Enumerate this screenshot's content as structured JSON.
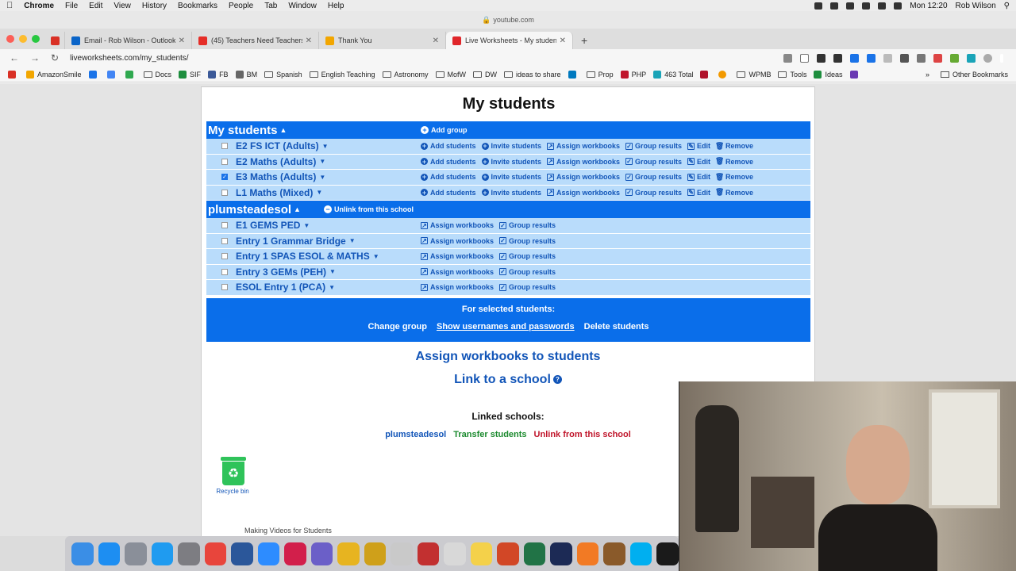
{
  "menubar": {
    "app": "Chrome",
    "items": [
      "File",
      "Edit",
      "View",
      "History",
      "Bookmarks",
      "People",
      "Tab",
      "Window",
      "Help"
    ],
    "clock": "Mon 12:20",
    "user": "Rob Wilson"
  },
  "browser": {
    "title_url": "youtube.com",
    "tabs": [
      {
        "label": "",
        "favicon_color": "#d93025",
        "icon": "gmail-icon"
      },
      {
        "label": "Email - Rob Wilson - Outlook",
        "favicon_color": "#0a64c8",
        "icon": "outlook-icon"
      },
      {
        "label": "(45) Teachers Need Teachers",
        "favicon_color": "#e52d27",
        "icon": "youtube-icon"
      },
      {
        "label": "Thank You",
        "favicon_color": "#f2a600",
        "icon": "amazon-icon"
      },
      {
        "label": "Live Worksheets - My students",
        "favicon_color": "#e0262a",
        "icon": "liveworksheets-icon",
        "active": true
      }
    ],
    "new_tab": "+",
    "address": "liveworksheets.com/my_students/",
    "bookmarks": [
      {
        "label": "",
        "icon": "gmail-icon",
        "color": "#d93025"
      },
      {
        "label": "AmazonSmile",
        "icon": "amazon-icon",
        "color": "#f2a600"
      },
      {
        "label": "",
        "icon": "calendar-icon",
        "color": "#1a73e8"
      },
      {
        "label": "",
        "icon": "google-icon",
        "color": "#4285f4"
      },
      {
        "label": "",
        "icon": "u-icon",
        "color": "#2fa84f"
      },
      {
        "label": "Docs",
        "icon": "folder",
        "color": ""
      },
      {
        "label": "SIF",
        "icon": "sheet-icon",
        "color": "#1e8e3e"
      },
      {
        "label": "FB",
        "icon": "facebook-icon",
        "color": "#3b5998"
      },
      {
        "label": "BM",
        "icon": "bm-icon",
        "color": "#666"
      },
      {
        "label": "Spanish",
        "icon": "folder",
        "color": ""
      },
      {
        "label": "English Teaching",
        "icon": "folder",
        "color": ""
      },
      {
        "label": "Astronomy",
        "icon": "folder",
        "color": ""
      },
      {
        "label": "MofW",
        "icon": "folder",
        "color": ""
      },
      {
        "label": "DW",
        "icon": "folder",
        "color": ""
      },
      {
        "label": "ideas to share",
        "icon": "folder",
        "color": ""
      },
      {
        "label": "",
        "icon": "trello-icon",
        "color": "#0079bf"
      },
      {
        "label": "Prop",
        "icon": "folder",
        "color": ""
      },
      {
        "label": "PHP",
        "icon": "php-icon",
        "color": "#c0152b"
      },
      {
        "label": "463 Total",
        "icon": "v-icon",
        "color": "#1aa4b8"
      },
      {
        "label": "",
        "icon": "red-square-icon",
        "color": "#b0122a"
      },
      {
        "label": "",
        "icon": "sun-icon",
        "color": "#f29900"
      },
      {
        "label": "WPMB",
        "icon": "folder",
        "color": ""
      },
      {
        "label": "Tools",
        "icon": "folder",
        "color": ""
      },
      {
        "label": "Ideas",
        "icon": "sheet-icon",
        "color": "#1e8e3e"
      },
      {
        "label": "",
        "icon": "purple-icon",
        "color": "#6a3ab2"
      }
    ],
    "other_bookmarks": "Other Bookmarks"
  },
  "page": {
    "title": "My students",
    "groups": [
      {
        "name": "My students",
        "header_action": "Add group",
        "header_icon": "plus-circle-icon",
        "rows": [
          {
            "name": "E2 FS ICT (Adults)",
            "checked": false,
            "actions": [
              "Add students",
              "Invite students",
              "Assign workbooks",
              "Group results",
              "Edit",
              "Remove"
            ]
          },
          {
            "name": "E2 Maths (Adults)",
            "checked": false,
            "actions": [
              "Add students",
              "Invite students",
              "Assign workbooks",
              "Group results",
              "Edit",
              "Remove"
            ]
          },
          {
            "name": "E3 Maths (Adults)",
            "checked": true,
            "actions": [
              "Add students",
              "Invite students",
              "Assign workbooks",
              "Group results",
              "Edit",
              "Remove"
            ]
          },
          {
            "name": "L1 Maths (Mixed)",
            "checked": false,
            "actions": [
              "Add students",
              "Invite students",
              "Assign workbooks",
              "Group results",
              "Edit",
              "Remove"
            ]
          }
        ]
      },
      {
        "name": "plumsteadesol",
        "header_action": "Unlink from this school",
        "header_icon": "minus-circle-icon",
        "rows": [
          {
            "name": "E1 GEMS PED",
            "checked": false,
            "actions": [
              "Assign workbooks",
              "Group results"
            ]
          },
          {
            "name": "Entry 1 Grammar Bridge",
            "checked": false,
            "actions": [
              "Assign workbooks",
              "Group results"
            ]
          },
          {
            "name": "Entry 1 SPAS ESOL & MATHS",
            "checked": false,
            "actions": [
              "Assign workbooks",
              "Group results"
            ]
          },
          {
            "name": "Entry 3 GEMs (PEH)",
            "checked": false,
            "actions": [
              "Assign workbooks",
              "Group results"
            ]
          },
          {
            "name": "ESOL Entry 1 (PCA)",
            "checked": false,
            "actions": [
              "Assign workbooks",
              "Group results"
            ]
          }
        ]
      }
    ],
    "selected_bar": {
      "title": "For selected students:",
      "change_group": "Change group",
      "show_passwords": "Show usernames and passwords",
      "delete": "Delete students"
    },
    "assign_link": "Assign workbooks to students",
    "school_link": "Link to a school",
    "help_mark": "?",
    "linked_title": "Linked schools:",
    "linked": {
      "school": "plumsteadesol",
      "transfer": "Transfer students",
      "unlink": "Unlink from this school"
    },
    "recycle_label": "Recycle bin",
    "footer_ghost": "Making Videos for Students"
  },
  "colors": {
    "accent": "#0a6eea",
    "row_bg": "#b9dcfb",
    "link": "#1255b8",
    "transfer": "#1b8a2e",
    "unlink": "#c0152b"
  },
  "dock": [
    {
      "name": "finder-icon",
      "color": "#3a8ee6"
    },
    {
      "name": "app-store-icon",
      "color": "#1d8ef2"
    },
    {
      "name": "launchpad-icon",
      "color": "#8a8f99"
    },
    {
      "name": "safari-icon",
      "color": "#1f9bf0"
    },
    {
      "name": "system-preferences-icon",
      "color": "#7d7d82"
    },
    {
      "name": "chrome-icon",
      "color": "#e8453c"
    },
    {
      "name": "word-icon",
      "color": "#2b579a"
    },
    {
      "name": "zoom-icon",
      "color": "#2d8cff"
    },
    {
      "name": "lips-icon",
      "color": "#d21f4b"
    },
    {
      "name": "imovie-icon",
      "color": "#6b5fc8"
    },
    {
      "name": "bus-icon",
      "color": "#e7b420"
    },
    {
      "name": "sticky-icon",
      "color": "#cfa01a"
    },
    {
      "name": "preview-icon",
      "color": "#c9c9c9"
    },
    {
      "name": "pen-icon",
      "color": "#c23030"
    },
    {
      "name": "textedit-icon",
      "color": "#d8d8d8"
    },
    {
      "name": "notes-icon",
      "color": "#f4d14a"
    },
    {
      "name": "powerpoint-icon",
      "color": "#d24726"
    },
    {
      "name": "excel-icon",
      "color": "#217346"
    },
    {
      "name": "sn7-icon",
      "color": "#1c2a55"
    },
    {
      "name": "orange-icon",
      "color": "#f27a24"
    },
    {
      "name": "character-icon",
      "color": "#8a5a2a"
    },
    {
      "name": "skype-icon",
      "color": "#00aff0"
    },
    {
      "name": "person-icon",
      "color": "#1a1a1a"
    }
  ]
}
